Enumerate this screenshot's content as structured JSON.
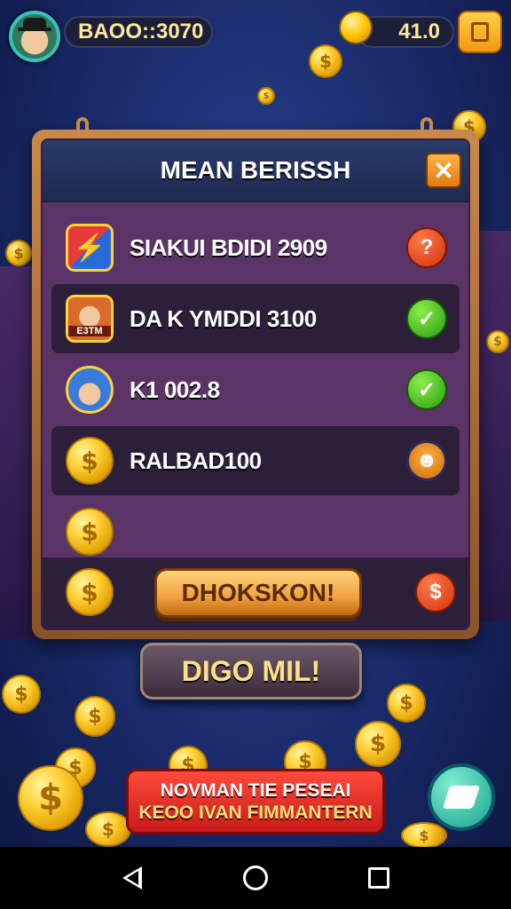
{
  "topbar": {
    "score_text": "BAOO::3070",
    "gold_text": "41.0"
  },
  "panel": {
    "title": "MEAN BERISSH",
    "close_glyph": "✕",
    "rows": [
      {
        "label": "SIAKUI BDIDI 2909",
        "status": "red",
        "status_glyph": "?"
      },
      {
        "label": "DA K YMDDI 3100",
        "status": "green",
        "status_glyph": "✓"
      },
      {
        "label": "K1 002.8",
        "status": "green",
        "status_glyph": "✓"
      },
      {
        "label": "RALBAD100",
        "status": "mascot",
        "status_glyph": "☻"
      }
    ],
    "avatar_tag": "E3TM",
    "action_label": "DHOKSKON!",
    "action_status_glyph": "$"
  },
  "secondary_button": {
    "label": "DIGO MIL!"
  },
  "promo": {
    "line1": "NOVMAN TIE PESEAI",
    "line2": "KEOO IVAN FIMMANTERN"
  },
  "coin_symbol": "$",
  "colors": {
    "panel_bg": "#5a3466",
    "header_bg": "#1d2a52",
    "gold": "#ffd23a",
    "promo_red": "#c81a1a",
    "status_green": "#2a9a10",
    "status_red": "#d4300a"
  },
  "icons": {
    "row1": "shield-lightning-icon",
    "row2": "avatar-glasses-icon",
    "row3": "avatar-cap-icon",
    "row4": "coin-icon",
    "nav": [
      "back-icon",
      "home-icon",
      "recent-apps-icon"
    ]
  }
}
